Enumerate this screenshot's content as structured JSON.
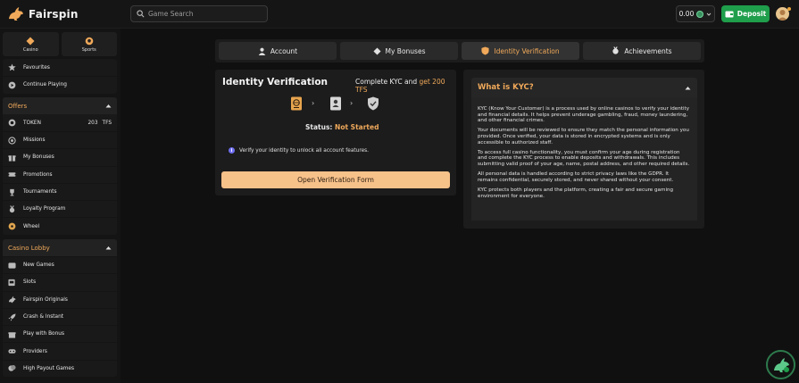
{
  "header": {
    "brand": "Fairspin",
    "search_placeholder": "Game Search",
    "balance": "0.00",
    "deposit_label": "Deposit"
  },
  "sidebar": {
    "tabs": [
      {
        "label": "Casino"
      },
      {
        "label": "Sports"
      }
    ],
    "top_items": [
      {
        "label": "Favourites"
      },
      {
        "label": "Continue Playing"
      }
    ],
    "offers": {
      "title": "Offers",
      "token_label": "TOKEN",
      "token_amount": "203",
      "token_unit": "TFS",
      "items": [
        {
          "label": "Missions"
        },
        {
          "label": "My Bonuses"
        },
        {
          "label": "Promotions"
        },
        {
          "label": "Tournaments"
        },
        {
          "label": "Loyalty Program"
        },
        {
          "label": "Wheel"
        }
      ]
    },
    "lobby": {
      "title": "Casino Lobby",
      "items": [
        {
          "label": "New Games"
        },
        {
          "label": "Slots"
        },
        {
          "label": "Fairspin Originals"
        },
        {
          "label": "Crash & Instant"
        },
        {
          "label": "Play with Bonus"
        },
        {
          "label": "Providers"
        },
        {
          "label": "High Payout Games"
        }
      ]
    }
  },
  "tabs": [
    {
      "label": "Account"
    },
    {
      "label": "My Bonuses"
    },
    {
      "label": "Identity Verification"
    },
    {
      "label": "Achievements"
    }
  ],
  "verification": {
    "title": "Identity Verification",
    "kyc_prefix": "Complete KYC and ",
    "kyc_highlight": "get 200 TFS",
    "status_label": "Status: ",
    "status_value": "Not Started",
    "info_text": "Verify your identity to unlock all account features.",
    "button_label": "Open Verification Form"
  },
  "faq": {
    "title": "What is KYC?",
    "paragraphs": [
      "KYC (Know Your Customer) is a process used by online casinos to verify your identity and financial details. It helps prevent underage gambling, fraud, money laundering, and other financial crimes.",
      "Your documents will be reviewed to ensure they match the personal information you provided. Once verified, your data is stored in encrypted systems and is only accessible to authorized staff.",
      "To access full casino functionality, you must confirm your age during registration and complete the KYC process to enable deposits and withdrawals. This includes submitting valid proof of your age, name, postal address, and other required details.",
      "All personal data is handled according to strict privacy laws like the GDPR. It remains confidential, securely stored, and never shared without your consent.",
      "KYC protects both players and the platform, creating a fair and secure gaming environment for everyone."
    ]
  },
  "colors": {
    "accent": "#f0a95a",
    "deposit": "#1f9e4b",
    "button": "#f7c18a"
  }
}
